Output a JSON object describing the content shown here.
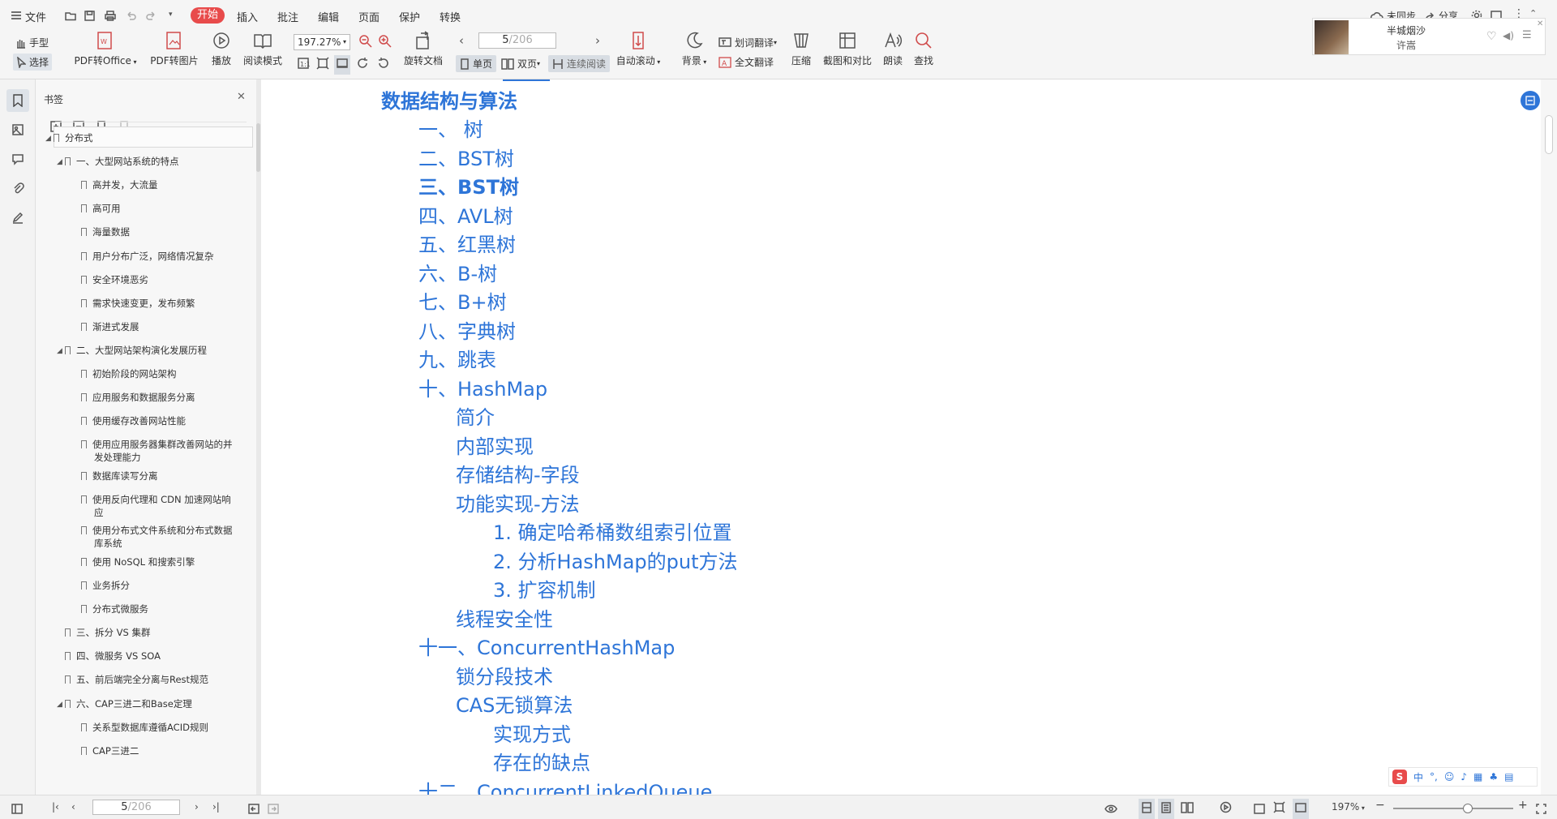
{
  "menu": {
    "file": "文件",
    "start": "开始",
    "insert": "插入",
    "annotate": "批注",
    "edit": "编辑",
    "page": "页面",
    "protect": "保护",
    "convert": "转换"
  },
  "topright": {
    "sync": "未同步",
    "share": "分享"
  },
  "media": {
    "title": "半城烟沙",
    "artist": "许嵩"
  },
  "toolbar": {
    "hand": "手型",
    "select": "选择",
    "pdf_office": "PDF转Office",
    "pdf_image": "PDF转图片",
    "play": "播放",
    "read_mode": "阅读模式",
    "zoom": "197.27%",
    "rotate": "旋转文档",
    "page_current": "5",
    "page_total": "/206",
    "single": "单页",
    "double": "双页",
    "continuous": "连续阅读",
    "auto_scroll": "自动滚动",
    "background": "背景",
    "word_translate": "划词翻译",
    "full_translate": "全文翻译",
    "compress": "压缩",
    "screenshot": "截图和对比",
    "read_aloud": "朗读",
    "find": "查找"
  },
  "bookmarks": {
    "title": "书签",
    "items": [
      {
        "label": "分布式",
        "level": 0,
        "expand": true
      },
      {
        "label": "一、大型网站系统的特点",
        "level": 1,
        "expand": true
      },
      {
        "label": "高并发，大流量",
        "level": 2
      },
      {
        "label": "高可用",
        "level": 2
      },
      {
        "label": "海量数据",
        "level": 2
      },
      {
        "label": "用户分布广泛，网络情况复杂",
        "level": 2
      },
      {
        "label": "安全环境恶劣",
        "level": 2
      },
      {
        "label": "需求快速变更，发布频繁",
        "level": 2
      },
      {
        "label": "渐进式发展",
        "level": 2
      },
      {
        "label": "二、大型网站架构演化发展历程",
        "level": 1,
        "expand": true
      },
      {
        "label": "初始阶段的网站架构",
        "level": 2
      },
      {
        "label": "应用服务和数据服务分离",
        "level": 2
      },
      {
        "label": "使用缓存改善网站性能",
        "level": 2
      },
      {
        "label": "使用应用服务器集群改善网站的并",
        "label2": "发处理能力",
        "level": 2
      },
      {
        "label": "数据库读写分离",
        "level": 2
      },
      {
        "label": "使用反向代理和 CDN 加速网站响",
        "label2": "应",
        "level": 2
      },
      {
        "label": "使用分布式文件系统和分布式数据",
        "label2": "库系统",
        "level": 2
      },
      {
        "label": "使用 NoSQL 和搜索引擎",
        "level": 2
      },
      {
        "label": "业务拆分",
        "level": 2
      },
      {
        "label": "分布式微服务",
        "level": 2
      },
      {
        "label": "三、拆分 VS 集群",
        "level": 1
      },
      {
        "label": "四、微服务 VS SOA",
        "level": 1
      },
      {
        "label": "五、前后端完全分离与Rest规范",
        "level": 1
      },
      {
        "label": "六、CAP三进二和Base定理",
        "level": 1,
        "expand": true
      },
      {
        "label": "关系型数据库遵循ACID规则",
        "level": 2
      },
      {
        "label": "CAP三进二",
        "level": 2
      }
    ]
  },
  "document": {
    "heading": "数据结构与算法",
    "entries": [
      {
        "text": "一、 树",
        "indent": 1
      },
      {
        "text": "二、BST树",
        "indent": 1
      },
      {
        "text": "三、BST树",
        "indent": 1,
        "bold": true
      },
      {
        "text": "四、AVL树",
        "indent": 1
      },
      {
        "text": "五、红黑树",
        "indent": 1
      },
      {
        "text": "六、B-树",
        "indent": 1
      },
      {
        "text": "七、B+树",
        "indent": 1
      },
      {
        "text": "八、字典树",
        "indent": 1
      },
      {
        "text": "九、跳表",
        "indent": 1
      },
      {
        "text": "十、HashMap",
        "indent": 1
      },
      {
        "text": "简介",
        "indent": 2
      },
      {
        "text": "内部实现",
        "indent": 2
      },
      {
        "text": "存储结构-字段",
        "indent": 2
      },
      {
        "text": "功能实现-方法",
        "indent": 2
      },
      {
        "text": "1. 确定哈希桶数组索引位置",
        "indent": 3
      },
      {
        "text": "2. 分析HashMap的put方法",
        "indent": 3
      },
      {
        "text": "3. 扩容机制",
        "indent": 3
      },
      {
        "text": "线程安全性",
        "indent": 2
      },
      {
        "text": "十一、ConcurrentHashMap",
        "indent": 1
      },
      {
        "text": "锁分段技术",
        "indent": 2
      },
      {
        "text": "CAS无锁算法",
        "indent": 2
      },
      {
        "text": "实现方式",
        "indent": 3
      },
      {
        "text": "存在的缺点",
        "indent": 3
      },
      {
        "text": "十二、ConcurrentLinkedQueue",
        "indent": 1
      }
    ]
  },
  "status": {
    "page_current": "5",
    "page_total": "/206",
    "zoom": "197%",
    "zoom_fraction": 0.62
  },
  "ime": {
    "lang": "中"
  },
  "colors": {
    "accent": "#e84b4b",
    "link": "#2e75d8"
  }
}
